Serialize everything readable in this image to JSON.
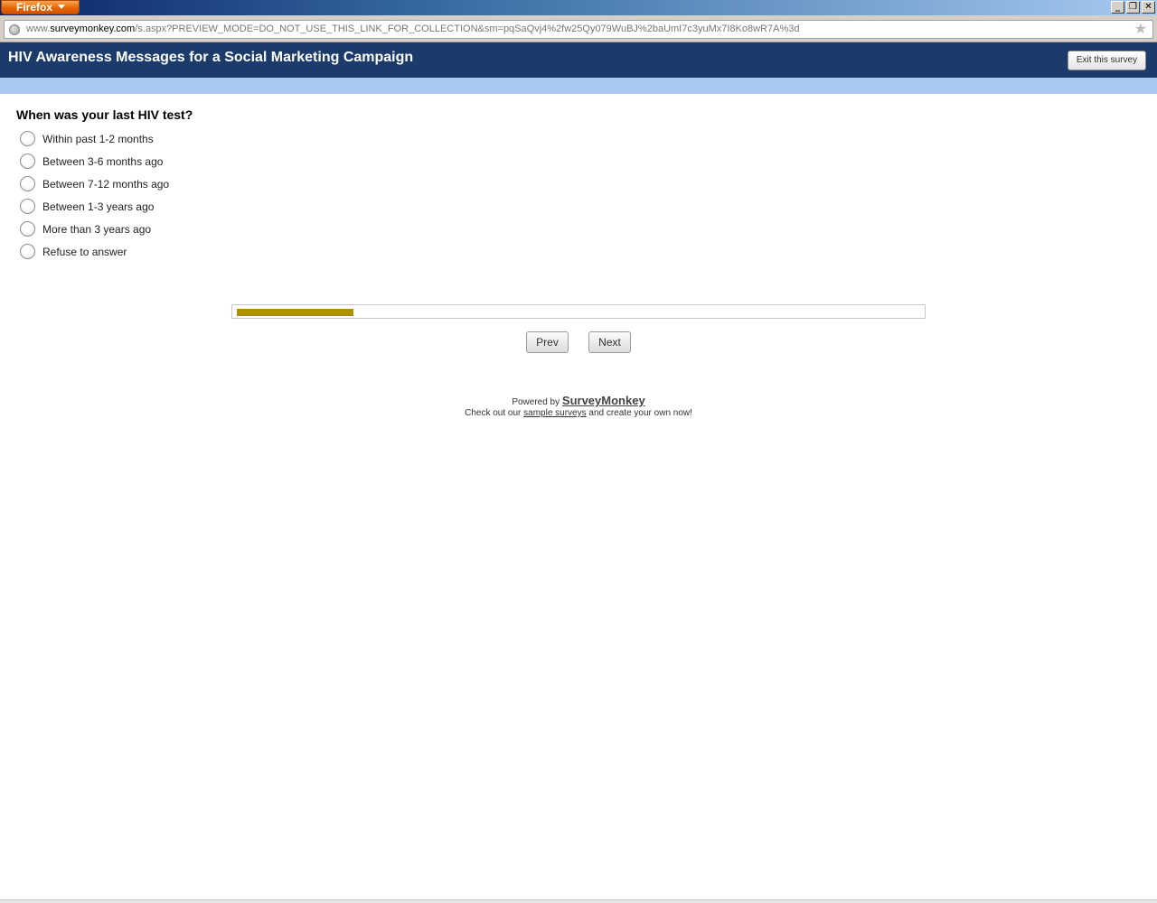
{
  "browser": {
    "menu_label": "Firefox",
    "url_prefix": "www.",
    "url_domain": "surveymonkey.com",
    "url_path": "/s.aspx?PREVIEW_MODE=DO_NOT_USE_THIS_LINK_FOR_COLLECTION&sm=pqSaQvj4%2fw25Qy079WuBJ%2baUmI7c3yuMx7I8Ko8wR7A%3d",
    "window_controls": [
      "minimize",
      "restore",
      "close"
    ]
  },
  "survey": {
    "title": "HIV Awareness Messages for a Social Marketing Campaign",
    "exit_label": "Exit this survey",
    "header_color": "#1b3c6b",
    "band_color": "#a9c8ef"
  },
  "question": {
    "text": "When was your last HIV test?",
    "options": [
      "Within past 1-2 months",
      "Between 3-6 months ago",
      "Between 7-12 months ago",
      "Between 1-3 years ago",
      "More than 3 years ago",
      "Refuse to answer"
    ]
  },
  "progress": {
    "fraction": 0.17,
    "color": "#ad8f00"
  },
  "nav": {
    "prev_label": "Prev",
    "next_label": "Next"
  },
  "footer": {
    "powered_by": "Powered by",
    "brand": "SurveyMonkey",
    "checkout_prefix": "Check out our",
    "checkout_link": "sample surveys",
    "checkout_suffix": "and create your own now!"
  }
}
